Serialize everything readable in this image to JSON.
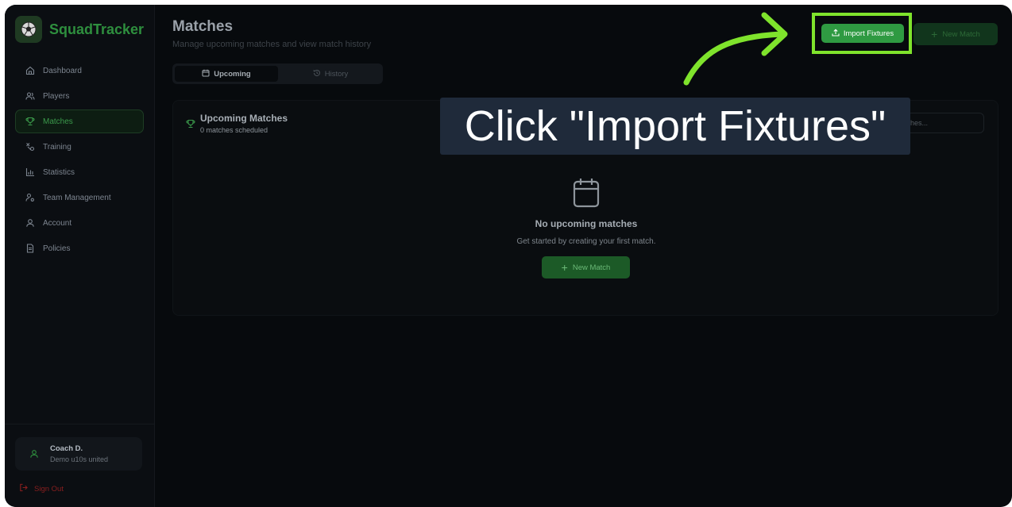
{
  "app": {
    "name": "SquadTracker",
    "logo_icon": "soccer-ball-icon",
    "accent_color": "#2f9a42"
  },
  "sidebar": {
    "items": [
      {
        "label": "Dashboard",
        "icon": "home-icon",
        "active": false
      },
      {
        "label": "Players",
        "icon": "users-icon",
        "active": false
      },
      {
        "label": "Matches",
        "icon": "trophy-icon",
        "active": true
      },
      {
        "label": "Training",
        "icon": "training-icon",
        "active": false
      },
      {
        "label": "Statistics",
        "icon": "bar-chart-icon",
        "active": false
      },
      {
        "label": "Team Management",
        "icon": "user-cog-icon",
        "active": false
      },
      {
        "label": "Account",
        "icon": "user-icon",
        "active": false
      },
      {
        "label": "Policies",
        "icon": "document-icon",
        "active": false
      }
    ],
    "user": {
      "name": "Coach D.",
      "team": "Demo u10s united",
      "icon": "user-icon"
    },
    "sign_out_label": "Sign Out"
  },
  "header": {
    "title": "Matches",
    "subtitle": "Manage upcoming matches and view match history",
    "import_label": "Import Fixtures",
    "new_match_label": "New Match"
  },
  "tabs": [
    {
      "label": "Upcoming",
      "icon": "calendar-icon",
      "active": true
    },
    {
      "label": "History",
      "icon": "history-icon",
      "active": false
    }
  ],
  "panel": {
    "title": "Upcoming Matches",
    "subtitle": "0 matches scheduled",
    "search_placeholder": "atches...",
    "empty_title": "No upcoming matches",
    "empty_subtitle": "Get started by creating your first match.",
    "empty_button_label": "New Match"
  },
  "overlay": {
    "instruction": "Click \"Import Fixtures\"",
    "highlight_color": "#7fe32c"
  }
}
